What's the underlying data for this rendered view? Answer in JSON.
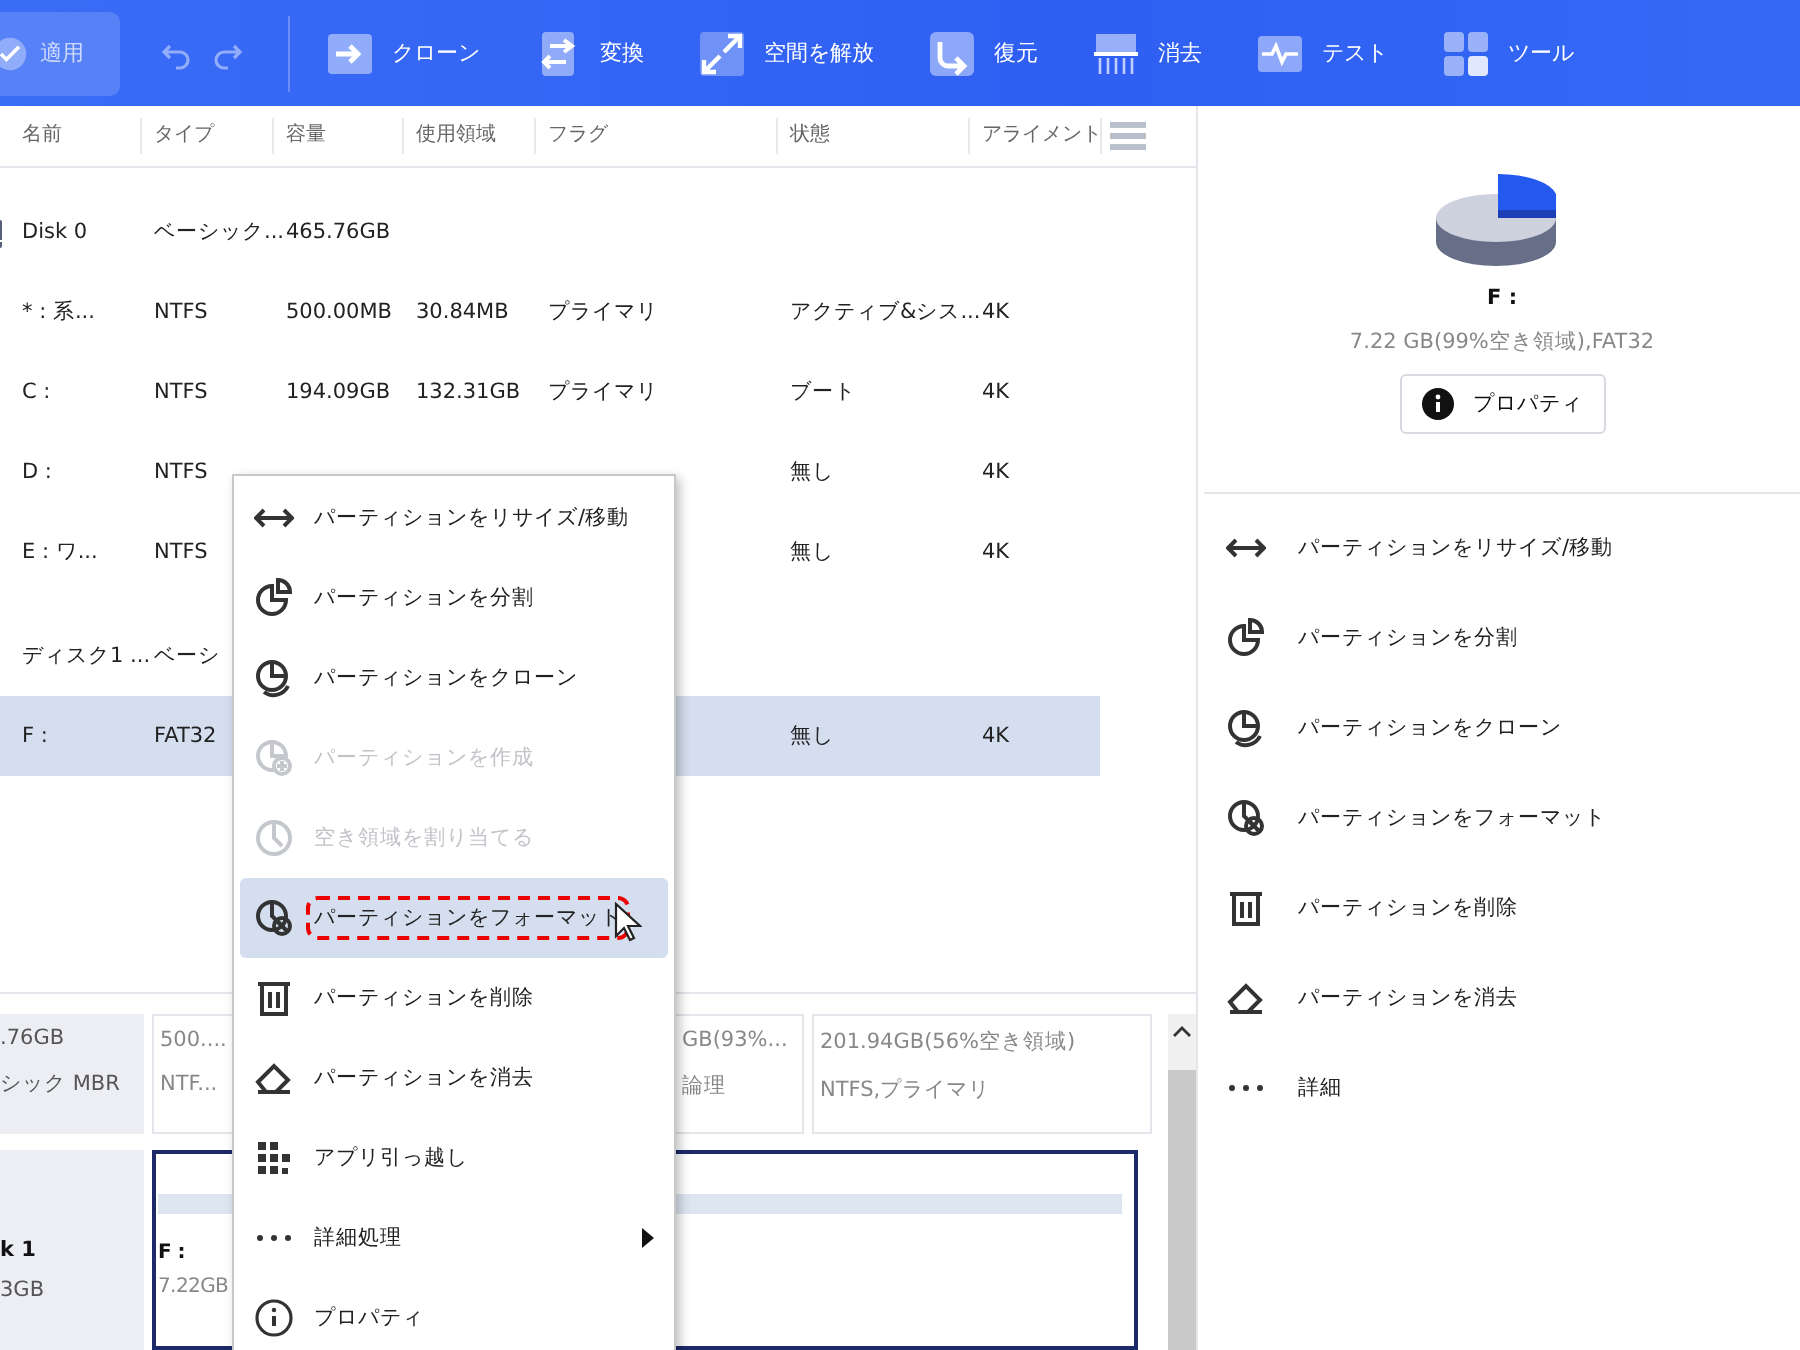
{
  "toolbar": {
    "apply": "適用",
    "tools": [
      {
        "label": "クローン"
      },
      {
        "label": "変換"
      },
      {
        "label": "空間を解放"
      },
      {
        "label": "復元"
      },
      {
        "label": "消去"
      },
      {
        "label": "テスト"
      },
      {
        "label": "ツール"
      }
    ]
  },
  "table": {
    "columns": [
      "名前",
      "タイプ",
      "容量",
      "使用領域",
      "フラグ",
      "状態",
      "アライメント"
    ],
    "rows": [
      {
        "kind": "disk",
        "show_icon": true,
        "cells": [
          "Disk 0",
          "ベーシック...",
          "465.76GB",
          "",
          "",
          "",
          ""
        ],
        "selected": false
      },
      {
        "kind": "partition",
        "cells": [
          "* : 系...",
          "NTFS",
          "500.00MB",
          "30.84MB",
          "プライマリ",
          "アクティブ&シス...",
          "4K"
        ],
        "selected": false
      },
      {
        "kind": "partition",
        "cells": [
          "C :",
          "NTFS",
          "194.09GB",
          "132.31GB",
          "プライマリ",
          "ブート",
          "4K"
        ],
        "selected": false
      },
      {
        "kind": "partition",
        "cells": [
          "D :",
          "NTFS",
          "",
          "",
          "",
          "無し",
          "4K"
        ],
        "selected": false
      },
      {
        "kind": "partition",
        "cells": [
          "E : ワ...",
          "NTFS",
          "",
          "",
          "",
          "無し",
          "4K"
        ],
        "selected": false
      },
      {
        "kind": "disk",
        "show_icon": false,
        "cells": [
          "ディスク1 ...",
          "ベーシ",
          "",
          "",
          "",
          "",
          ""
        ],
        "selected": false
      },
      {
        "kind": "partition",
        "cells": [
          "F :",
          "FAT32",
          "",
          "",
          "",
          "無し",
          "4K"
        ],
        "selected": true
      }
    ]
  },
  "disk_map": {
    "disks": [
      {
        "info": [
          ".76GB",
          "シック MBR"
        ],
        "parts": [
          {
            "lines": [
              "500....",
              "NTF..."
            ],
            "selected": false,
            "bar": false
          },
          {
            "lines": [
              "GB(93%...",
              "論理"
            ],
            "selected": false,
            "bar": false
          },
          {
            "lines": [
              "201.94GB(56%空き領域)",
              "NTFS,プライマリ"
            ],
            "selected": false,
            "bar": false
          }
        ]
      },
      {
        "info": [
          "3GB"
        ],
        "bold_name": "k 1",
        "parts": [
          {
            "lines": [
              "F :",
              "7.22GB"
            ],
            "selected": true,
            "bar": true
          }
        ]
      }
    ]
  },
  "context_menu": [
    {
      "label": "パーティションをリサイズ/移動",
      "disabled": false,
      "selected": false,
      "submenu": false
    },
    {
      "label": "パーティションを分割",
      "disabled": false,
      "selected": false,
      "submenu": false
    },
    {
      "label": "パーティションをクローン",
      "disabled": false,
      "selected": false,
      "submenu": false
    },
    {
      "label": "パーティションを作成",
      "disabled": true,
      "selected": false,
      "submenu": false
    },
    {
      "label": "空き領域を割り当てる",
      "disabled": true,
      "selected": false,
      "submenu": false
    },
    {
      "label": "パーティションをフォーマット",
      "disabled": false,
      "selected": true,
      "submenu": false
    },
    {
      "label": "パーティションを削除",
      "disabled": false,
      "selected": false,
      "submenu": false
    },
    {
      "label": "パーティションを消去",
      "disabled": false,
      "selected": false,
      "submenu": false
    },
    {
      "label": "アプリ引っ越し",
      "disabled": false,
      "selected": false,
      "submenu": false
    },
    {
      "label": "詳細処理",
      "disabled": false,
      "selected": false,
      "submenu": true
    },
    {
      "label": "プロパティ",
      "disabled": false,
      "selected": false,
      "submenu": false
    }
  ],
  "details": {
    "name": "F :",
    "summary": "7.22 GB(99%空き領域),FAT32",
    "properties_button": "プロパティ",
    "actions": [
      "パーティションをリサイズ/移動",
      "パーティションを分割",
      "パーティションをクローン",
      "パーティションをフォーマット",
      "パーティションを削除",
      "パーティションを消去",
      "詳細"
    ]
  }
}
